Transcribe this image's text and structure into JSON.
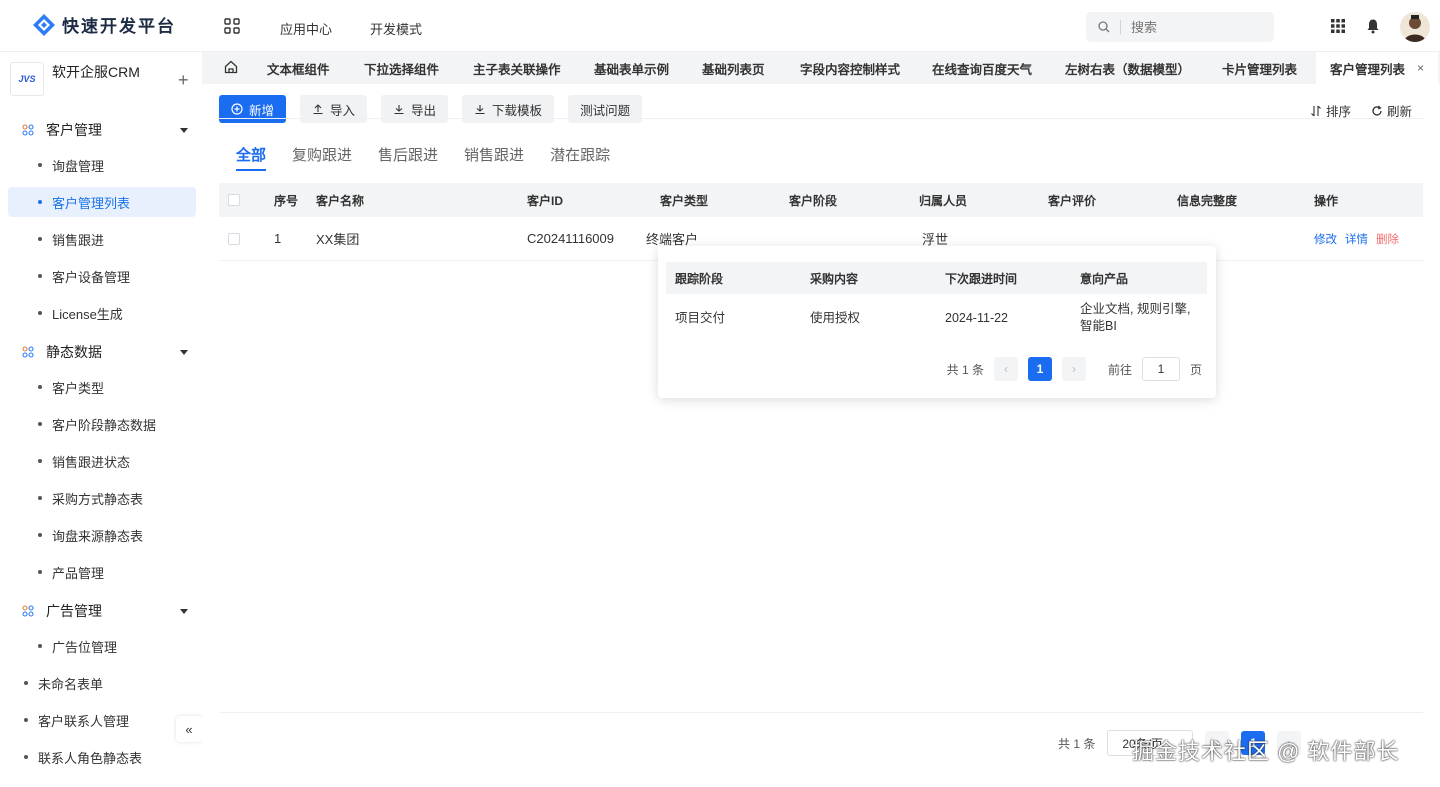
{
  "header": {
    "brand": "快速开发平台",
    "nav": [
      "应用中心",
      "开发模式"
    ],
    "search_placeholder": "搜索"
  },
  "sidebar": {
    "project_logo": "JVS",
    "project_name": "软开企服CRM",
    "add_symbol": "+",
    "collapse_symbol": "«",
    "groups": [
      {
        "label": "客户管理",
        "items": [
          "询盘管理",
          "客户管理列表",
          "销售跟进",
          "客户设备管理",
          "License生成"
        ]
      },
      {
        "label": "静态数据",
        "items": [
          "客户类型",
          "客户阶段静态数据",
          "销售跟进状态",
          "采购方式静态表",
          "询盘来源静态表",
          "产品管理"
        ]
      },
      {
        "label": "广告管理",
        "items": [
          "广告位管理"
        ]
      }
    ],
    "top_items": [
      "未命名表单",
      "客户联系人管理",
      "联系人角色静态表"
    ],
    "active_item": "客户管理列表"
  },
  "tabs": {
    "items": [
      "文本框组件",
      "下拉选择组件",
      "主子表关联操作",
      "基础表单示例",
      "基础列表页",
      "字段内容控制样式",
      "在线查询百度天气",
      "左树右表（数据模型）",
      "卡片管理列表",
      "客户管理列表"
    ],
    "active": "客户管理列表",
    "close_symbol": "×"
  },
  "toolbar": {
    "new": "新增",
    "import": "导入",
    "export": "导出",
    "download_template": "下载模板",
    "test": "测试问题",
    "sort": "排序",
    "refresh": "刷新"
  },
  "subtabs": {
    "items": [
      "全部",
      "复购跟进",
      "售后跟进",
      "销售跟进",
      "潜在跟踪"
    ],
    "active": "全部"
  },
  "table": {
    "columns": [
      "序号",
      "客户名称",
      "客户ID",
      "客户类型",
      "客户阶段",
      "归属人员",
      "客户评价",
      "信息完整度",
      "操作"
    ],
    "rows": [
      {
        "index": "1",
        "name": "XX集团",
        "id": "C20241116009",
        "type": "终端客户",
        "stage": "",
        "owner": "浮世",
        "rating": "",
        "completeness": ""
      }
    ],
    "actions": {
      "edit": "修改",
      "detail": "详情",
      "delete": "删除"
    }
  },
  "popover": {
    "columns": [
      "跟踪阶段",
      "采购内容",
      "下次跟进时间",
      "意向产品"
    ],
    "row": {
      "stage": "项目交付",
      "content": "使用授权",
      "next_time": "2024-11-22",
      "products": "企业文档, 规则引擎, 智能BI"
    },
    "pager": {
      "total": "共 1 条",
      "current": "1",
      "goto_label": "前往",
      "goto_value": "1",
      "page_unit": "页"
    }
  },
  "footer_pager": {
    "total": "共 1 条",
    "page_size": "20条/页",
    "current": "1"
  },
  "watermark": "掘金技术社区 @ 软件部长",
  "colors": {
    "primary": "#1a6cf0",
    "danger": "#f56c6c",
    "active_bg": "#e8f0fe"
  }
}
